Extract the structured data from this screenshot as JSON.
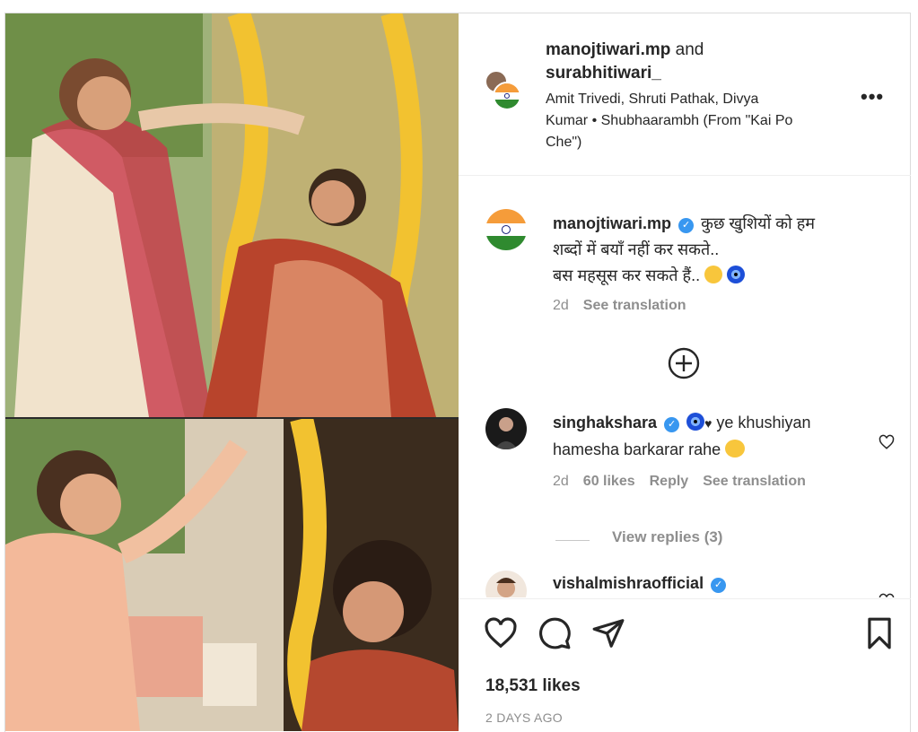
{
  "header": {
    "user1": "manojtiwari.mp",
    "and_text": "and",
    "user2": "surabhitiwari_",
    "audio_line1": "Amit Trivedi, Shruti Pathak, Divya",
    "audio_line2": "Kumar • Shubhaarambh (From \"Kai Po",
    "audio_line3": "Che\")",
    "more_label": "•••"
  },
  "caption": {
    "username": "manojtiwari.mp",
    "verified": "✓",
    "line1": "कुछ खुशियों को हम",
    "line2": "शब्दों में बयाँ नहीं कर सकते..",
    "line3": "बस महसूस कर सकते हैं..",
    "time": "2d",
    "translate": "See translation"
  },
  "comments": [
    {
      "username": "singhakshara",
      "verified": "✓",
      "text1": "ye khushiyan",
      "text2": "hamesha barkarar rahe",
      "time": "2d",
      "likes": "60 likes",
      "reply": "Reply",
      "translate": "See translation",
      "view_replies": "View replies (3)"
    },
    {
      "username": "vishalmishraofficial",
      "verified": "✓"
    }
  ],
  "footer": {
    "likes": "18,531 likes",
    "date": "2 DAYS AGO"
  },
  "colors": {
    "verified": "#3897f0",
    "muted": "#8e8e8e",
    "text": "#262626"
  },
  "icons": {
    "like": "heart-icon",
    "comment": "comment-icon",
    "share": "paper-plane-icon",
    "save": "bookmark-icon",
    "add": "plus-circle-icon"
  }
}
